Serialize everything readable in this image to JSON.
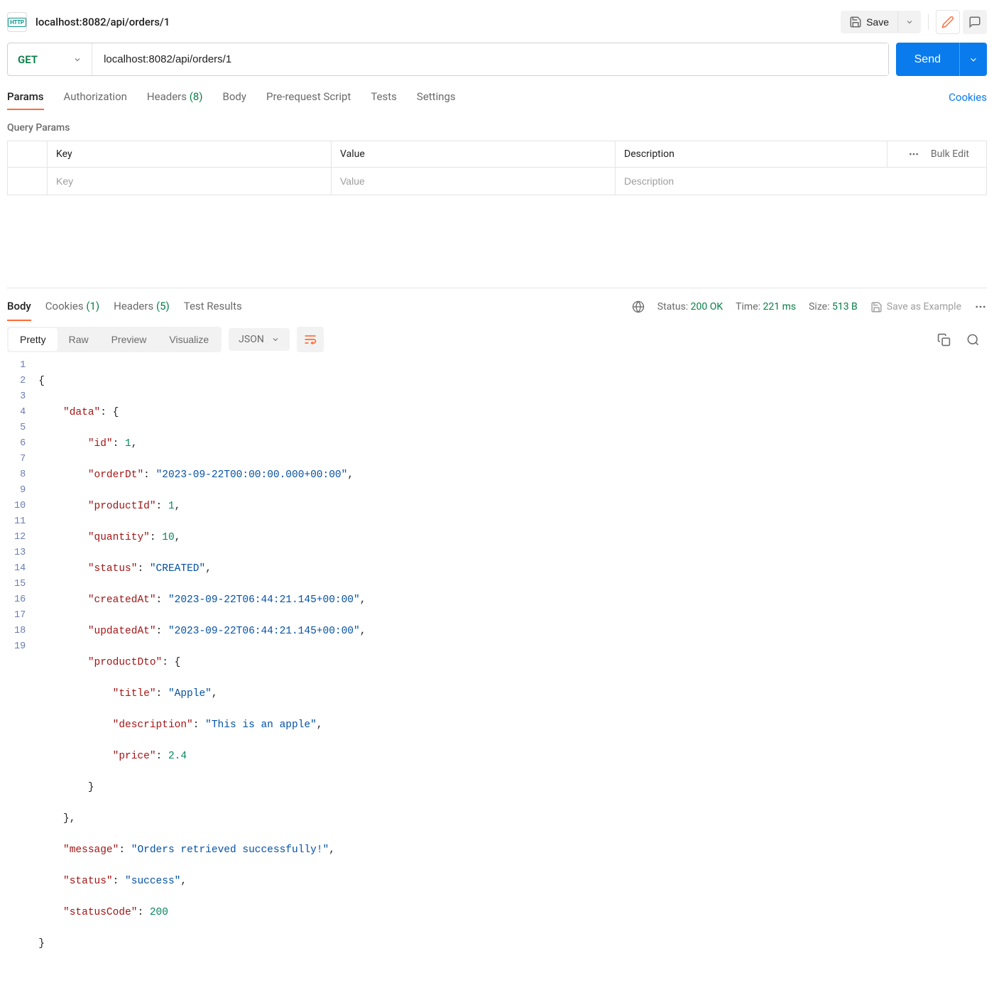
{
  "header": {
    "breadcrumb": "localhost:8082/api/orders/1",
    "save_label": "Save"
  },
  "request": {
    "method": "GET",
    "url": "localhost:8082/api/orders/1",
    "send_label": "Send"
  },
  "req_tabs": {
    "params": "Params",
    "authorization": "Authorization",
    "headers": "Headers",
    "headers_count": "(8)",
    "body": "Body",
    "prerequest": "Pre-request Script",
    "tests": "Tests",
    "settings": "Settings",
    "cookies_link": "Cookies"
  },
  "query_params": {
    "title": "Query Params",
    "col_key": "Key",
    "col_value": "Value",
    "col_desc": "Description",
    "bulk_edit": "Bulk Edit",
    "ph_key": "Key",
    "ph_value": "Value",
    "ph_desc": "Description"
  },
  "resp_tabs": {
    "body": "Body",
    "cookies": "Cookies",
    "cookies_count": "(1)",
    "headers": "Headers",
    "headers_count": "(5)",
    "test_results": "Test Results"
  },
  "resp_meta": {
    "status_label": "Status:",
    "status_value": "200 OK",
    "time_label": "Time:",
    "time_value": "221 ms",
    "size_label": "Size:",
    "size_value": "513 B",
    "save_example": "Save as Example"
  },
  "view_modes": {
    "pretty": "Pretty",
    "raw": "Raw",
    "preview": "Preview",
    "visualize": "Visualize",
    "json": "JSON"
  },
  "json_body": {
    "l1": "{",
    "l2_k": "\"data\"",
    "l2_r": ": {",
    "l3_k": "\"id\"",
    "l3_v": "1",
    "l3_r": ",",
    "l4_k": "\"orderDt\"",
    "l4_v": "\"2023-09-22T00:00:00.000+00:00\"",
    "l4_r": ",",
    "l5_k": "\"productId\"",
    "l5_v": "1",
    "l5_r": ",",
    "l6_k": "\"quantity\"",
    "l6_v": "10",
    "l6_r": ",",
    "l7_k": "\"status\"",
    "l7_v": "\"CREATED\"",
    "l7_r": ",",
    "l8_k": "\"createdAt\"",
    "l8_v": "\"2023-09-22T06:44:21.145+00:00\"",
    "l8_r": ",",
    "l9_k": "\"updatedAt\"",
    "l9_v": "\"2023-09-22T06:44:21.145+00:00\"",
    "l9_r": ",",
    "l10_k": "\"productDto\"",
    "l10_r": ": {",
    "l11_k": "\"title\"",
    "l11_v": "\"Apple\"",
    "l11_r": ",",
    "l12_k": "\"description\"",
    "l12_v": "\"This is an apple\"",
    "l12_r": ",",
    "l13_k": "\"price\"",
    "l13_v": "2.4",
    "l14": "}",
    "l15": "},",
    "l16_k": "\"message\"",
    "l16_v": "\"Orders retrieved successfully!\"",
    "l16_r": ",",
    "l17_k": "\"status\"",
    "l17_v": "\"success\"",
    "l17_r": ",",
    "l18_k": "\"statusCode\"",
    "l18_v": "200",
    "l19": "}"
  }
}
